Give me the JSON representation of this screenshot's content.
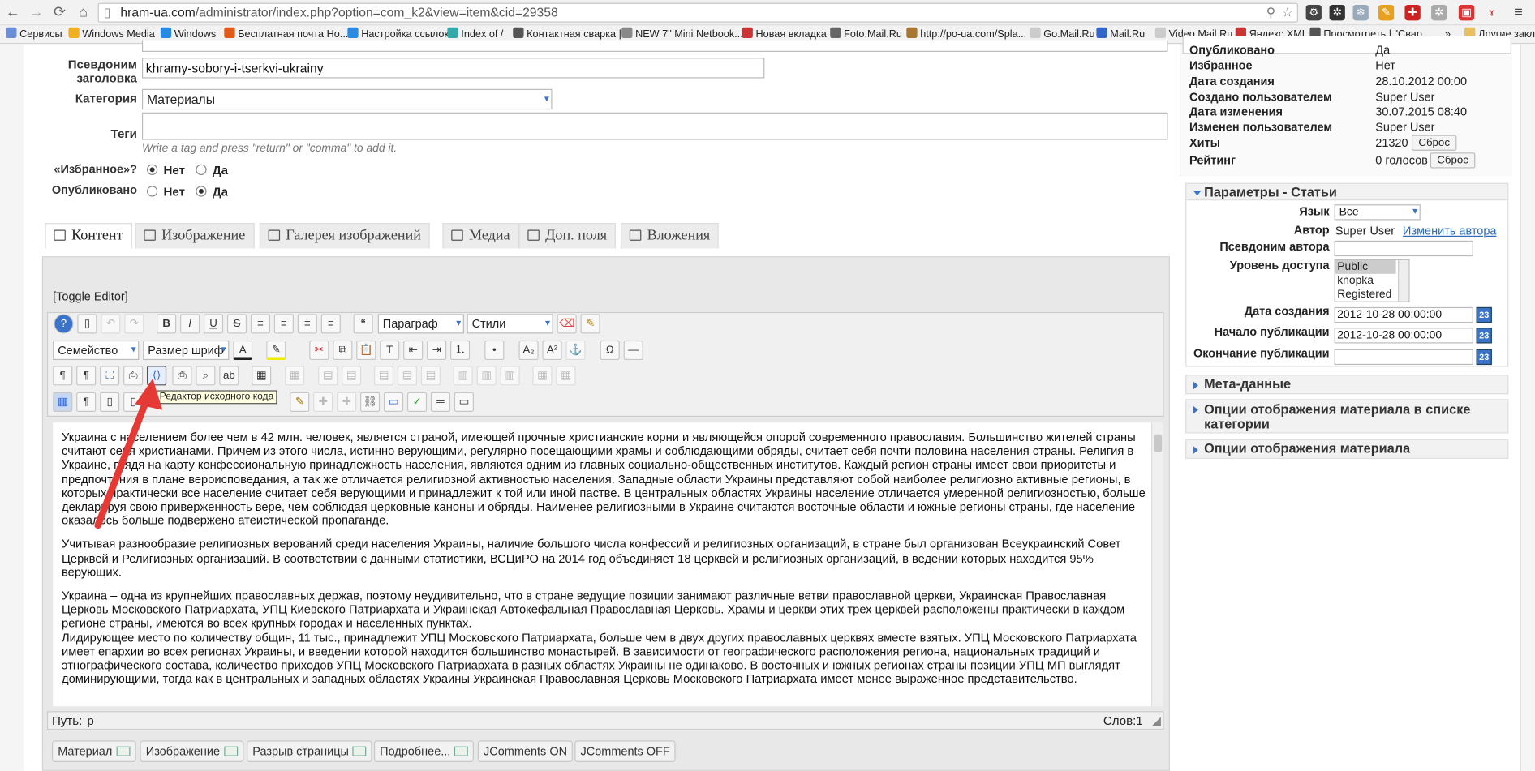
{
  "browser": {
    "url_host": "hram-ua.com",
    "url_path": "/administrator/index.php?option=com_k2&view=item&cid=29358",
    "bookmarks": [
      "Сервисы",
      "Windows Media",
      "Windows",
      "Бесплатная почта Но...",
      "Настройка ссылок",
      "Index of /",
      "Контактная сварка |",
      "NEW 7\" Mini Netbook...",
      "Новая вкладка",
      "Foto.Mail.Ru",
      "http://po-ua.com/Spla...",
      "Go.Mail.Ru",
      "Mail.Ru",
      "Video.Mail.Ru",
      "Яндекс.XML",
      "Просмотреть | \"Свар...",
      "»",
      "Другие закл"
    ]
  },
  "form": {
    "alias_label": "Псевдоним заголовка",
    "alias_value": "khramy-sobory-i-tserkvi-ukrainy",
    "category_label": "Категория",
    "category_value": "Материалы",
    "tags_label": "Теги",
    "tags_hint": "Write a tag and press \"return\" or \"comma\" to add it.",
    "featured_label": "«Избранное»?",
    "published_label": "Опубликовано",
    "no": "Нет",
    "yes": "Да"
  },
  "tabs": [
    "Контент",
    "Изображение",
    "Галерея изображений",
    "Медиа",
    "Доп. поля",
    "Вложения"
  ],
  "editor": {
    "toggle": "[Toggle Editor]",
    "paragraph_select": "Параграф",
    "styles_select": "Стили",
    "family_select": "Семейство",
    "size_select": "Размер шриф",
    "tooltip": "Редактор исходного кода",
    "paragraphs": [
      "Украина с населением более чем в 42 млн. человек, является страной, имеющей прочные христианские корни и являющейся опорой современного православия. Большинство жителей страны считают себя христианами. Причем из этого числа, истинно верующими, регулярно посещающими храмы и соблюдающими обряды, считает себя почти половина населения страны. Религия в Украине, глядя на карту конфессиональную принадлежность населения, являются одним из главных социально-общественных институтов. Каждый регион страны имеет свои приоритеты и предпочтения в плане вероисповедания, а так же отличается религиозной активностью населения. Западные области Украины представляют собой наиболее религиозно активные регионы, в которых практически все население считает себя верующими и принадлежит к той или иной пастве. В центральных областях Украины население отличается умеренной религиозностью, больше декларируя свою приверженность вере, чем соблюдая церковные каноны и обряды. Наименее религиозными в Украине считаются восточные области и южные регионы страны, где население оказалось больше подвержено атеистической пропаганде.",
      "Учитывая разнообразие религиозных верований среди населения Украины, наличие большого числа конфессий и религиозных организаций, в стране был организован Всеукраинский Совет Церквей и Религиозных организаций. В соответствии с данными статистики, ВСЦиРО на 2014 год объединяет 18 церквей и религиозных организаций, в ведении которых находится 95% верующих.",
      "Украина – одна из крупнейших православных держав, поэтому неудивительно, что в стране ведущие позиции занимают различные ветви православной церкви, Украинская Православная Церковь Московского Патриархата, УПЦ Киевского Патриархата и Украинская Автокефальная Православная Церковь. Храмы и церкви этих трех церквей расположены практически в каждом регионе страны, имеются во всех крупных городах и населенных пунктах.",
      "Лидирующее место по количеству общин, 11 тыс., принадлежит УПЦ Московского Патриархата, больше чем в двух других православных церквях вместе взятых. УПЦ Московского Патриархата имеет епархии во всех регионах Украины, и введении которой находится большинство монастырей. В зависимости от географического расположения региона, национальных традиций и этнографического состава, количество приходов УПЦ Московского Патриархата в разных областях Украины не одинаково. В восточных и южных регионах страны позиции УПЦ МП выглядят доминирующими, тогда как в центральных и западных областях Украины Украинская Православная Церковь Московского Патриархата имеет менее выраженное представительство."
    ],
    "path_label": "Путь:",
    "path_value": "p",
    "words": "Слов:1",
    "bottom_buttons": [
      "Материал",
      "Изображение",
      "Разрыв страницы",
      "Подробнее...",
      "JComments ON",
      "JComments OFF"
    ]
  },
  "info": {
    "rows": [
      {
        "label": "Опубликовано",
        "value": "Да"
      },
      {
        "label": "Избранное",
        "value": "Нет"
      },
      {
        "label": "Дата создания",
        "value": "28.10.2012 00:00"
      },
      {
        "label": "Создано пользователем",
        "value": "Super User"
      },
      {
        "label": "Дата изменения",
        "value": "30.07.2015 08:40"
      },
      {
        "label": "Изменен пользователем",
        "value": "Super User"
      },
      {
        "label": "Хиты",
        "value": "21320"
      },
      {
        "label": "Рейтинг",
        "value": "0 голосов"
      }
    ],
    "reset": "Сброс"
  },
  "params": {
    "title": "Параметры - Статьи",
    "lang_label": "Язык",
    "lang_value": "Все",
    "author_label": "Автор",
    "author_value": "Super User",
    "change_author": "Изменить автора",
    "alias_author_label": "Псевдоним автора",
    "access_label": "Уровень доступа",
    "access_options": [
      "Public",
      "knopka",
      "Registered"
    ],
    "created_label": "Дата создания",
    "created_value": "2012-10-28 00:00:00",
    "start_label": "Начало публикации",
    "start_value": "2012-10-28 00:00:00",
    "end_label": "Окончание публикации",
    "cal_icon": "23"
  },
  "sections": [
    "Мета-данные",
    "Опции отображения материала в списке категории",
    "Опции отображения материала"
  ],
  "colors": {
    "accent": "#3a73c8",
    "arrow": "#e53935",
    "link": "#2a6ab8"
  }
}
